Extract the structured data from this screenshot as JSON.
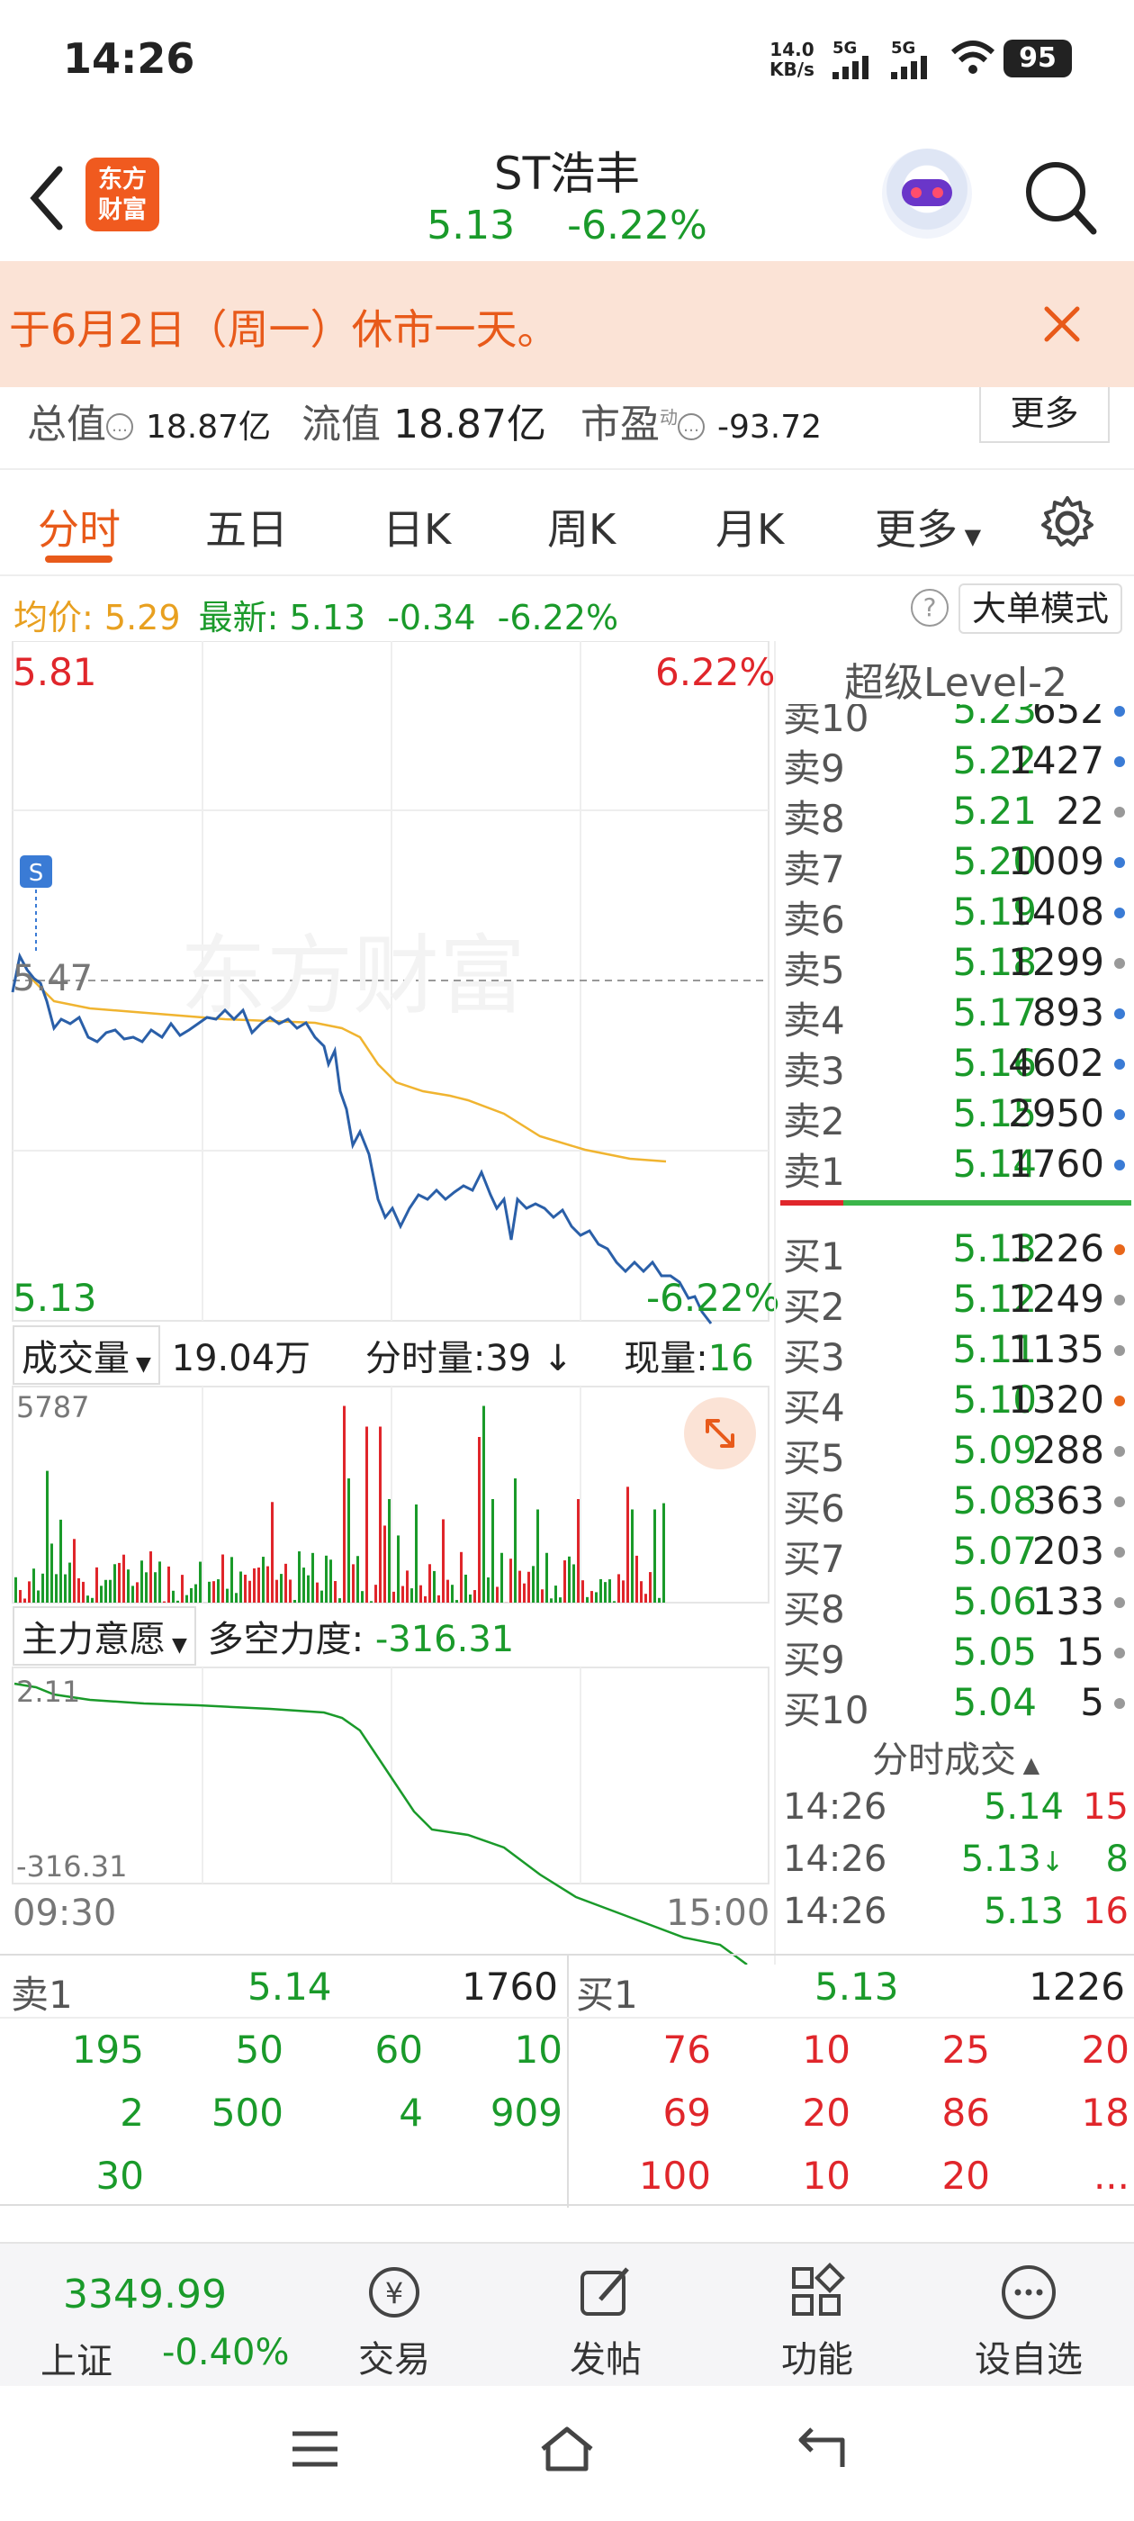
{
  "status": {
    "time": "14:26",
    "net_speed": "14.0",
    "net_unit": "KB/s",
    "sig1": "5G",
    "sig2": "5G",
    "battery": "95"
  },
  "header": {
    "logo_line1": "东方",
    "logo_line2": "财富",
    "title": "ST浩丰",
    "price": "5.13",
    "change_pct": "-6.22%"
  },
  "notice": {
    "text": "于6月2日（周一）休市一天。"
  },
  "info": {
    "total_label": "总值",
    "total_value": "18.87亿",
    "float_label": "流值",
    "float_value": "18.87亿",
    "pe_label": "市盈",
    "pe_sup": "动",
    "pe_value": "-93.72",
    "more": "更多"
  },
  "tabs": [
    "分时",
    "五日",
    "日K",
    "周K",
    "月K",
    "更多"
  ],
  "price_line": {
    "avg_label": "均价:",
    "avg_value": "5.29",
    "latest_label": "最新:",
    "latest_value": "5.13",
    "change": "-0.34",
    "pct": "-6.22%",
    "help": "?",
    "mode_btn": "大单模式"
  },
  "chart": {
    "top_price": "5.81",
    "top_pct": "6.22%",
    "mid_price": "5.47",
    "bottom_price": "5.13",
    "bottom_pct": "-6.22%",
    "s_marker": "S",
    "watermark": "东方财富",
    "price_line_color": "#2a5fa8",
    "avg_line_color": "#f0b430",
    "volume_label": "成交量",
    "volume_value": "19.04万",
    "period_vol_label": "分时量:39",
    "now_label": "现量:",
    "now_value": "16",
    "vol_max": "5787",
    "intent_label": "主力意愿",
    "force_label": "多空力度:",
    "force_value": "-316.31",
    "intent_top": "2.11",
    "intent_bottom": "-316.31",
    "time_start": "09:30",
    "time_end": "15:00"
  },
  "chart_data": {
    "type": "line",
    "x_range": [
      "09:30",
      "15:00"
    ],
    "ylim": [
      5.13,
      5.81
    ],
    "reference_price": 5.47,
    "series": [],
    "intent_range": [
      -316.31,
      2.11
    ]
  },
  "level2": {
    "title": "超级Level-2",
    "asks": [
      {
        "label": "卖10",
        "price": "5.23",
        "vol": "652",
        "dot": "#3a7bd5"
      },
      {
        "label": "卖9",
        "price": "5.22",
        "vol": "1427",
        "dot": "#3a7bd5"
      },
      {
        "label": "卖8",
        "price": "5.21",
        "vol": "22",
        "dot": "#999"
      },
      {
        "label": "卖7",
        "price": "5.20",
        "vol": "1009",
        "dot": "#3a7bd5"
      },
      {
        "label": "卖6",
        "price": "5.19",
        "vol": "1408",
        "dot": "#3a7bd5"
      },
      {
        "label": "卖5",
        "price": "5.18",
        "vol": "1299",
        "dot": "#999"
      },
      {
        "label": "卖4",
        "price": "5.17",
        "vol": "893",
        "dot": "#3a7bd5"
      },
      {
        "label": "卖3",
        "price": "5.16",
        "vol": "4602",
        "dot": "#3a7bd5"
      },
      {
        "label": "卖2",
        "price": "5.15",
        "vol": "2950",
        "dot": "#3a7bd5"
      },
      {
        "label": "卖1",
        "price": "5.14",
        "vol": "1760",
        "dot": "#3a7bd5"
      }
    ],
    "bids": [
      {
        "label": "买1",
        "price": "5.13",
        "vol": "1226",
        "dot": "#e8661a"
      },
      {
        "label": "买2",
        "price": "5.12",
        "vol": "1249",
        "dot": "#999"
      },
      {
        "label": "买3",
        "price": "5.11",
        "vol": "1135",
        "dot": "#999"
      },
      {
        "label": "买4",
        "price": "5.10",
        "vol": "1320",
        "dot": "#e8661a"
      },
      {
        "label": "买5",
        "price": "5.09",
        "vol": "288",
        "dot": "#999"
      },
      {
        "label": "买6",
        "price": "5.08",
        "vol": "363",
        "dot": "#999"
      },
      {
        "label": "买7",
        "price": "5.07",
        "vol": "203",
        "dot": "#999"
      },
      {
        "label": "买8",
        "price": "5.06",
        "vol": "133",
        "dot": "#999"
      },
      {
        "label": "买9",
        "price": "5.05",
        "vol": "15",
        "dot": "#999"
      },
      {
        "label": "买10",
        "price": "5.04",
        "vol": "5",
        "dot": "#999"
      }
    ],
    "ticks_title": "分时成交",
    "ticks": [
      {
        "time": "14:26",
        "price": "5.14",
        "vol": "15",
        "arrow": ""
      },
      {
        "time": "14:26",
        "price": "5.13",
        "vol": "8",
        "arrow": "↓"
      },
      {
        "time": "14:26",
        "price": "5.13",
        "vol": "16",
        "arrow": ""
      }
    ]
  },
  "queue": {
    "ask_label": "卖1",
    "ask_price": "5.14",
    "ask_vol": "1760",
    "bid_label": "买1",
    "bid_price": "5.13",
    "bid_vol": "1226",
    "ask_rows": [
      [
        "195",
        "50",
        "60",
        "10"
      ],
      [
        "2",
        "500",
        "4",
        "909"
      ],
      [
        "30",
        "",
        "",
        ""
      ]
    ],
    "bid_rows": [
      [
        "76",
        "10",
        "25",
        "20"
      ],
      [
        "69",
        "20",
        "86",
        "18"
      ],
      [
        "100",
        "10",
        "20",
        "..."
      ]
    ]
  },
  "bottom_nav": {
    "index_value": "3349.99",
    "index_name": "上证",
    "index_change": "-0.40%",
    "items": [
      "交易",
      "发帖",
      "功能",
      "设自选"
    ]
  }
}
